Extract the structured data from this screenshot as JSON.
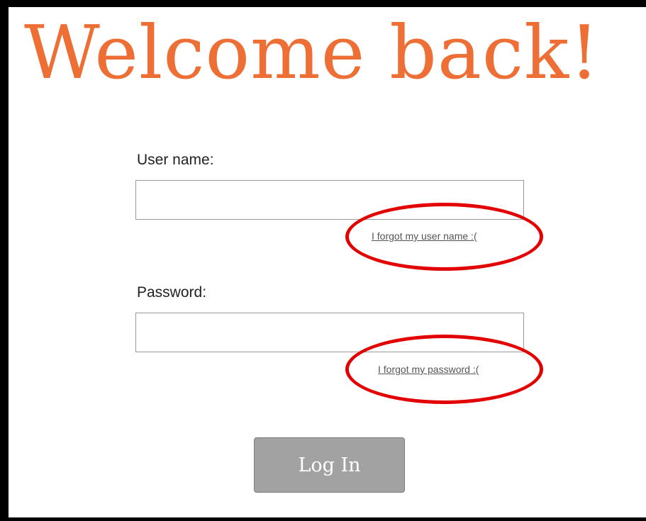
{
  "page": {
    "title": "Welcome back!"
  },
  "form": {
    "username": {
      "label": "User name:",
      "value": "",
      "forgot_link": "I forgot my user name :("
    },
    "password": {
      "label": "Password:",
      "value": "",
      "forgot_link": "I forgot my password :("
    },
    "submit_label": "Log In"
  },
  "annotations": {
    "highlight_color": "#e30000",
    "shape": "ellipse"
  },
  "colors": {
    "title": "#ee6f35",
    "button": "#a2a2a2",
    "button_text": "#ffffff"
  }
}
